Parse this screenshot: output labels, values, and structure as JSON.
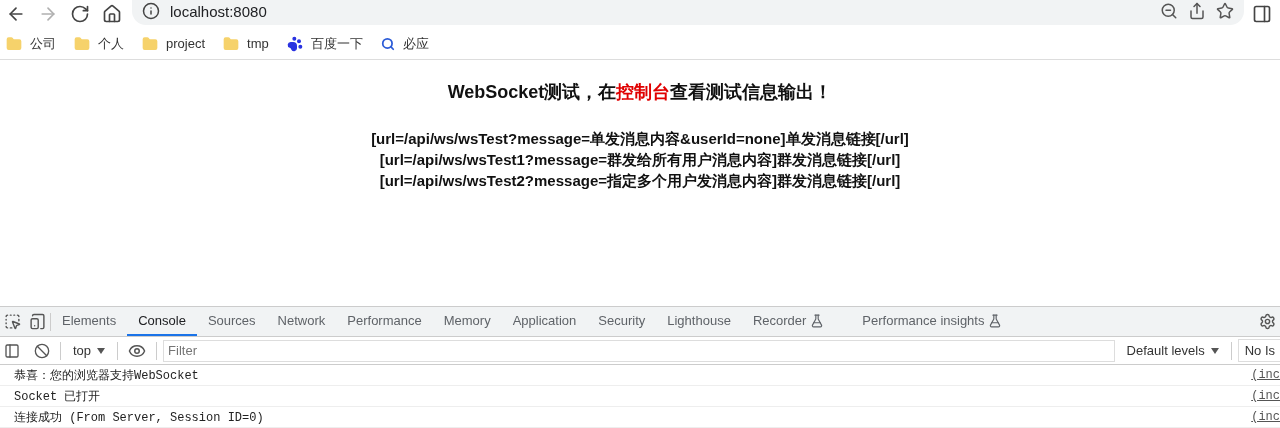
{
  "browser": {
    "nav_buttons": [
      {
        "kind": "back",
        "disabled": false
      },
      {
        "kind": "forward",
        "disabled": true
      },
      {
        "kind": "reload",
        "disabled": false
      },
      {
        "kind": "home",
        "disabled": false
      }
    ],
    "address": "localhost:8080",
    "bookmarks": [
      {
        "kind": "folder",
        "label": "公司"
      },
      {
        "kind": "folder",
        "label": "个人"
      },
      {
        "kind": "folder",
        "label": "project"
      },
      {
        "kind": "folder",
        "label": "tmp"
      },
      {
        "kind": "paw",
        "label": "百度一下"
      },
      {
        "kind": "search",
        "label": "必应"
      }
    ]
  },
  "page": {
    "heading": {
      "before": "WebSocket测试，在",
      "highlight": "控制台",
      "after": "查看测试信息输出！"
    },
    "links": [
      "[url=/api/ws/wsTest?message=单发消息内容&userId=none]单发消息链接[/url]",
      "[url=/api/ws/wsTest1?message=群发给所有用户消息内容]群发消息链接[/url]",
      "[url=/api/ws/wsTest2?message=指定多个用户发消息内容]群发消息链接[/url]"
    ]
  },
  "devtools": {
    "tabs": [
      {
        "label": "Elements",
        "selected": false,
        "experimental": false
      },
      {
        "label": "Console",
        "selected": true,
        "experimental": false
      },
      {
        "label": "Sources",
        "selected": false,
        "experimental": false
      },
      {
        "label": "Network",
        "selected": false,
        "experimental": false
      },
      {
        "label": "Performance",
        "selected": false,
        "experimental": false
      },
      {
        "label": "Memory",
        "selected": false,
        "experimental": false
      },
      {
        "label": "Application",
        "selected": false,
        "experimental": false
      },
      {
        "label": "Security",
        "selected": false,
        "experimental": false
      },
      {
        "label": "Lighthouse",
        "selected": false,
        "experimental": false
      },
      {
        "label": "Recorder",
        "selected": false,
        "experimental": true
      },
      {
        "label": "Performance insights",
        "selected": false,
        "experimental": true
      }
    ],
    "context": "top",
    "filter": {
      "placeholder": "Filter"
    },
    "levels": "Default levels",
    "issues": "No Is",
    "messages": [
      {
        "text": "恭喜：您的浏览器支持WebSocket",
        "source": "(inc"
      },
      {
        "text": "Socket 已打开",
        "source": "(inc"
      },
      {
        "text": "连接成功 (From Server, Session ID=0)",
        "source": "(inc"
      }
    ]
  }
}
